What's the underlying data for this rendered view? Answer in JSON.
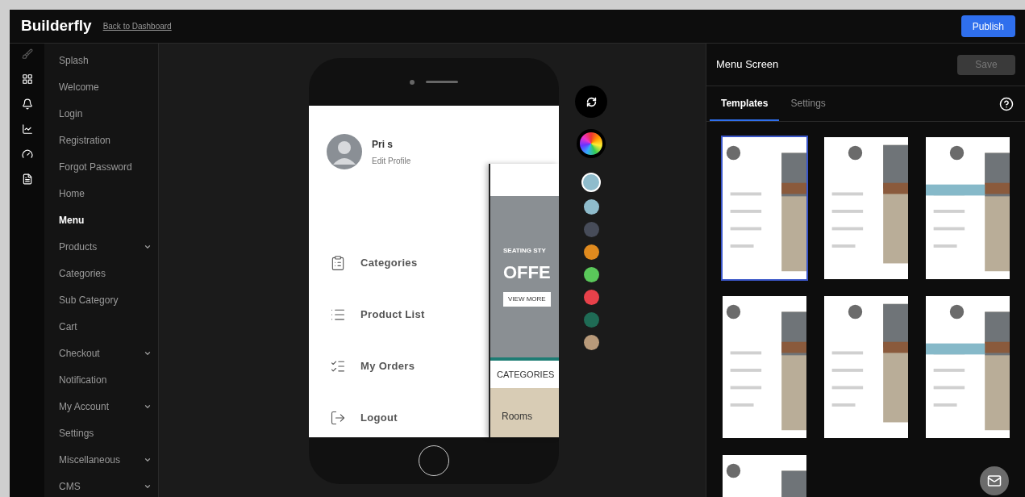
{
  "header": {
    "logo": "Builderfly",
    "back_link": "Back to Dashboard",
    "publish_button": "Publish"
  },
  "icon_rail": [
    {
      "kind": "brush",
      "selected": false
    },
    {
      "kind": "grid",
      "selected": true
    },
    {
      "kind": "bell",
      "selected": true
    },
    {
      "kind": "chart",
      "selected": true
    },
    {
      "kind": "gauge",
      "selected": true
    },
    {
      "kind": "file",
      "selected": true
    }
  ],
  "nav": [
    {
      "label": "Splash",
      "selected": false,
      "expandable": false
    },
    {
      "label": "Welcome",
      "selected": false,
      "expandable": false
    },
    {
      "label": "Login",
      "selected": false,
      "expandable": false
    },
    {
      "label": "Registration",
      "selected": false,
      "expandable": false
    },
    {
      "label": "Forgot Password",
      "selected": false,
      "expandable": false
    },
    {
      "label": "Home",
      "selected": false,
      "expandable": false
    },
    {
      "label": "Menu",
      "selected": true,
      "expandable": false
    },
    {
      "label": "Products",
      "selected": false,
      "expandable": true
    },
    {
      "label": "Categories",
      "selected": false,
      "expandable": false
    },
    {
      "label": "Sub Category",
      "selected": false,
      "expandable": false
    },
    {
      "label": "Cart",
      "selected": false,
      "expandable": false
    },
    {
      "label": "Checkout",
      "selected": false,
      "expandable": true
    },
    {
      "label": "Notification",
      "selected": false,
      "expandable": false
    },
    {
      "label": "My Account",
      "selected": false,
      "expandable": true
    },
    {
      "label": "Settings",
      "selected": false,
      "expandable": false
    },
    {
      "label": "Miscellaneous",
      "selected": false,
      "expandable": true
    },
    {
      "label": "CMS",
      "selected": false,
      "expandable": true
    }
  ],
  "phone": {
    "profile": {
      "name": "Pri s",
      "link": "Edit Profile"
    },
    "menu": [
      {
        "kind": "clipboard",
        "label": "Categories"
      },
      {
        "kind": "list",
        "label": "Product List"
      },
      {
        "kind": "checklist",
        "label": "My Orders"
      },
      {
        "kind": "logout",
        "label": "Logout"
      }
    ],
    "preview": {
      "banner_kicker": "SEATING STY",
      "banner_title": "OFFE",
      "banner_button": "VIEW MORE",
      "section_title": "CATEGORIES",
      "tile_label": "Rooms"
    }
  },
  "palette": [
    {
      "color": "#8fbccc",
      "selected": true
    },
    {
      "color": "#8fbccc",
      "selected": false
    },
    {
      "color": "#474c59",
      "selected": false
    },
    {
      "color": "#e08a1e",
      "selected": false
    },
    {
      "color": "#5ac85a",
      "selected": false
    },
    {
      "color": "#e8414a",
      "selected": false
    },
    {
      "color": "#1f6b55",
      "selected": false
    },
    {
      "color": "#b89a7a",
      "selected": false
    }
  ],
  "panel": {
    "title": "Menu Screen",
    "save_button": "Save",
    "tabs": [
      {
        "label": "Templates",
        "selected": true
      },
      {
        "label": "Settings",
        "selected": false
      }
    ],
    "templates": [
      {
        "kind": "picture",
        "selected": true
      },
      {
        "kind": "picture",
        "selected": false
      },
      {
        "kind": "picture",
        "selected": false
      },
      {
        "kind": "picture",
        "selected": false
      },
      {
        "kind": "picture",
        "selected": false
      },
      {
        "kind": "picture",
        "selected": false
      },
      {
        "kind": "picture",
        "selected": false
      }
    ]
  }
}
